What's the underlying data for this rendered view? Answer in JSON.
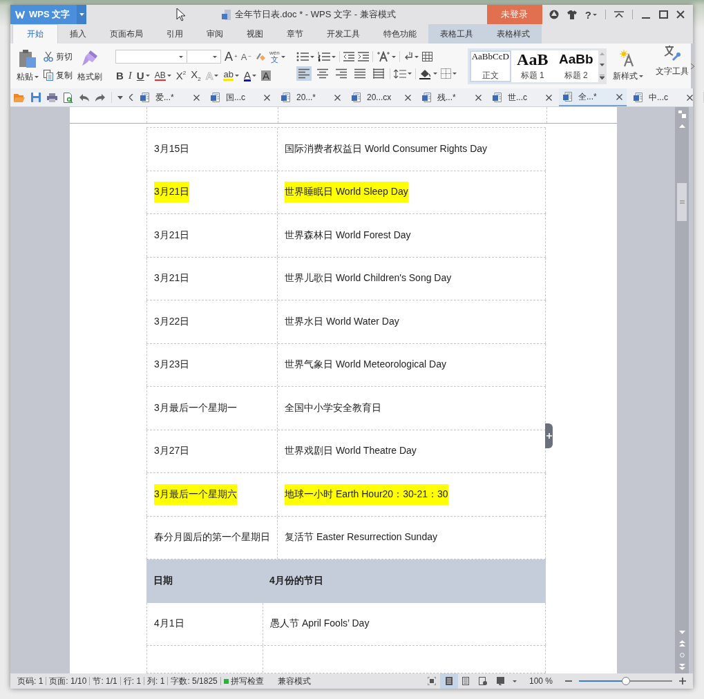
{
  "app_button": {
    "label": "WPS 文字"
  },
  "window": {
    "title": "全年节日表.doc * - WPS 文字 - 兼容模式"
  },
  "login_button": {
    "label": "未登录"
  },
  "help_button": {
    "label": "?"
  },
  "ribbon_tabs": [
    {
      "label": "开始",
      "selected": true,
      "kind": "main"
    },
    {
      "label": "插入",
      "selected": false,
      "kind": "main"
    },
    {
      "label": "页面布局",
      "selected": false,
      "kind": "main"
    },
    {
      "label": "引用",
      "selected": false,
      "kind": "main"
    },
    {
      "label": "审阅",
      "selected": false,
      "kind": "main"
    },
    {
      "label": "视图",
      "selected": false,
      "kind": "main"
    },
    {
      "label": "章节",
      "selected": false,
      "kind": "main"
    },
    {
      "label": "开发工具",
      "selected": false,
      "kind": "main"
    },
    {
      "label": "特色功能",
      "selected": false,
      "kind": "main"
    },
    {
      "label": "表格工具",
      "selected": false,
      "kind": "context"
    },
    {
      "label": "表格样式",
      "selected": false,
      "kind": "context"
    }
  ],
  "clipboard": {
    "paste": "粘贴",
    "cut": "剪切",
    "copy": "复制",
    "format_painter": "格式刷"
  },
  "size_buttons": [
    {
      "kind": "grow",
      "glyph": "A$^{+}$"
    },
    {
      "kind": "shrink",
      "glyph": "A$^{−}$"
    }
  ],
  "phonetic_button": {
    "ruby": "wén",
    "glyph": "文"
  },
  "font_buttons": [
    {
      "kind": "bold",
      "glyph": "B"
    },
    {
      "kind": "italic",
      "glyph": "I"
    },
    {
      "kind": "underline",
      "glyph": "U"
    },
    {
      "kind": "strike",
      "glyph": "AB"
    },
    {
      "kind": "superscript",
      "glyph": "X$^{2}$"
    },
    {
      "kind": "subscript",
      "glyph": "X$_{2}$"
    },
    {
      "kind": "effect",
      "glyph": "A"
    },
    {
      "kind": "highlight",
      "glyph": "ab"
    },
    {
      "kind": "font-color",
      "glyph": "A"
    },
    {
      "kind": "shading",
      "glyph": "A"
    }
  ],
  "align_buttons": [
    {
      "kind": "left",
      "selected": true
    },
    {
      "kind": "center",
      "selected": false
    },
    {
      "kind": "right",
      "selected": false
    },
    {
      "kind": "justify",
      "selected": false
    },
    {
      "kind": "distributed",
      "selected": false
    }
  ],
  "styles": [
    {
      "kind": "normal",
      "preview": "AaBbCcD",
      "label": "正文",
      "selected": true
    },
    {
      "kind": "heading1",
      "preview": "AaB",
      "label": "标题 1",
      "selected": false
    },
    {
      "kind": "heading2",
      "preview": "AaBb",
      "label": "标题 2",
      "selected": false
    }
  ],
  "new_style": {
    "label": "新样式"
  },
  "text_tools": {
    "label": "文字工具"
  },
  "doc_tabs": [
    {
      "label": "爱...*",
      "selected": false
    },
    {
      "label": "国...c",
      "selected": false
    },
    {
      "label": "20...*",
      "selected": false
    },
    {
      "label": "20...cx",
      "selected": false
    },
    {
      "label": "残...*",
      "selected": false
    },
    {
      "label": "世...c",
      "selected": false
    },
    {
      "label": "全...*",
      "selected": true
    },
    {
      "label": "中...c",
      "selected": false
    }
  ],
  "table": {
    "rows": [
      {
        "date": "3月15日",
        "holiday": "国际消费者权益日 World Consumer Rights Day",
        "highlighted": false
      },
      {
        "date": "3月21日",
        "holiday": "世界睡眠日 World Sleep Day",
        "highlighted": true
      },
      {
        "date": "3月21日",
        "holiday": "世界森林日 World Forest Day",
        "highlighted": false
      },
      {
        "date": "3月21日",
        "holiday": "世界儿歌日 World Children's Song Day",
        "highlighted": false
      },
      {
        "date": "3月22日",
        "holiday": "世界水日 World Water Day",
        "highlighted": false
      },
      {
        "date": "3月23日",
        "holiday": "世界气象日 World Meteorological Day",
        "highlighted": false
      },
      {
        "date": "3月最后一个星期一",
        "holiday": "全国中小学安全教育日",
        "highlighted": false
      },
      {
        "date": "3月27日",
        "holiday": "世界戏剧日 World Theatre Day",
        "highlighted": false
      },
      {
        "date": "3月最后一个星期六",
        "holiday": "地球一小时 Earth Hour20：30-21：30",
        "highlighted": true
      },
      {
        "date": "春分月圆后的第一个星期日",
        "holiday": "复活节 Easter Resurrection Sunday",
        "highlighted": false
      }
    ],
    "section": {
      "date_header": "日期",
      "title": "4月份的节日"
    },
    "rows_after": [
      {
        "date": "4月1日",
        "holiday": "愚人节 April Fools’ Day",
        "highlighted": false
      }
    ]
  },
  "status_bar": {
    "items": [
      "页码: 1",
      "页面: 1/10",
      "节: 1/1",
      "行: 1",
      "列: 1",
      "字数: 5/1825"
    ],
    "spell_check": "拼写检查",
    "mode": "兼容模式",
    "zoom": "100 %",
    "zoom_slider": {
      "level": 0.5
    }
  }
}
